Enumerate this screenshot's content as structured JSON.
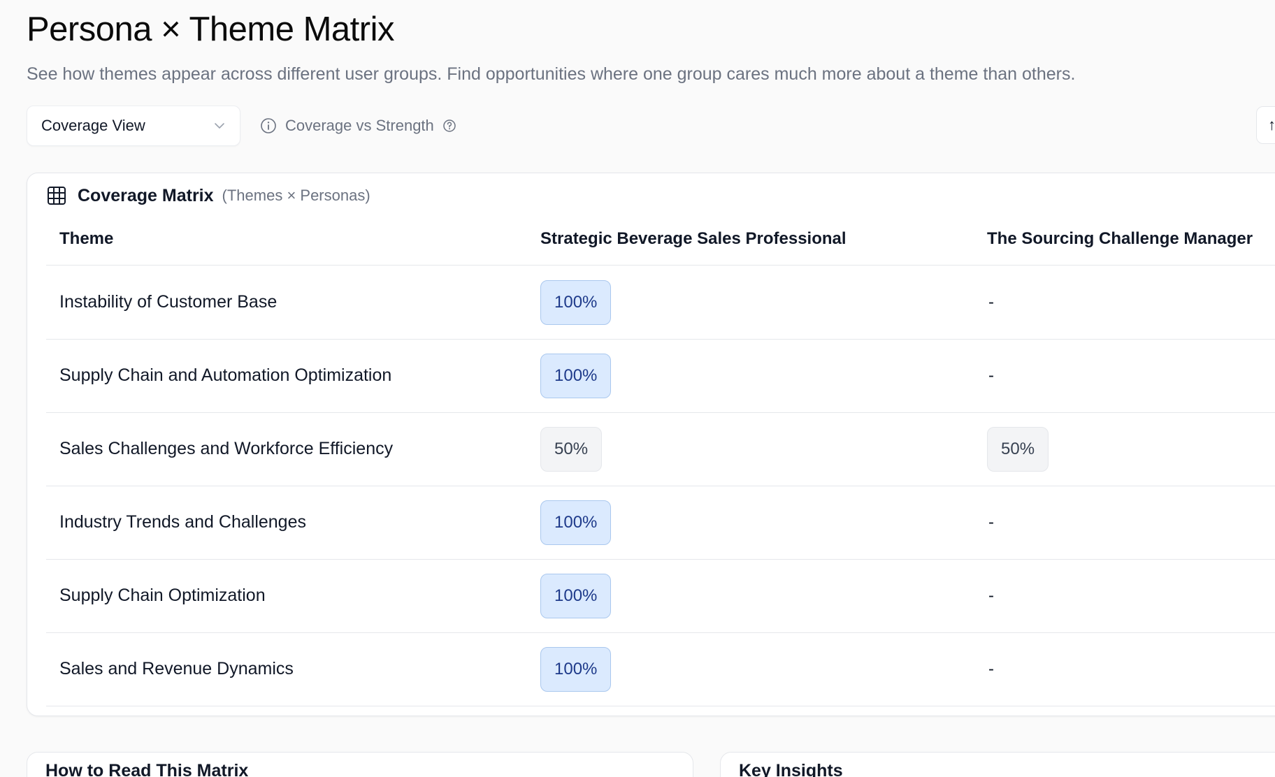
{
  "page": {
    "title": "Persona × Theme Matrix",
    "subtitle": "See how themes appear across different user groups. Find opportunities where one group cares much more about a theme than others."
  },
  "toolbar": {
    "view_select": {
      "value": "Coverage View",
      "icon": "chevron-down-icon"
    },
    "info_label": "Coverage vs Strength",
    "right_button_label": "↑"
  },
  "matrix": {
    "title": "Coverage Matrix",
    "subtitle": "(Themes × Personas)",
    "columns": {
      "theme": "Theme",
      "persona_1": "Strategic Beverage Sales Professional",
      "persona_2": "The Sourcing Challenge Manager"
    },
    "rows": [
      {
        "theme": "Instability of Customer Base",
        "p1": "100%",
        "p2": "-"
      },
      {
        "theme": "Supply Chain and Automation Optimization",
        "p1": "100%",
        "p2": "-"
      },
      {
        "theme": "Sales Challenges and Workforce Efficiency",
        "p1": "50%",
        "p2": "50%"
      },
      {
        "theme": "Industry Trends and Challenges",
        "p1": "100%",
        "p2": "-"
      },
      {
        "theme": "Supply Chain Optimization",
        "p1": "100%",
        "p2": "-"
      },
      {
        "theme": "Sales and Revenue Dynamics",
        "p1": "100%",
        "p2": "-"
      }
    ]
  },
  "bottom": {
    "how_to_read_title": "How to Read This Matrix",
    "key_insights_title": "Key Insights"
  },
  "colors": {
    "high_pill_bg": "#dbeafe",
    "high_pill_text": "#1e3a8a",
    "mid_pill_bg": "#f3f4f6",
    "mid_pill_text": "#374151"
  }
}
